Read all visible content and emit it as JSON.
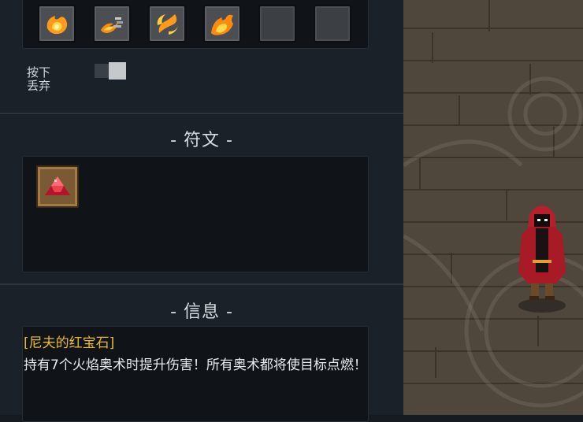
{
  "hotbar": {
    "slots": [
      {
        "icon": "fireball-icon",
        "filled": true
      },
      {
        "icon": "fire-dash-icon",
        "filled": true
      },
      {
        "icon": "fire-spin-icon",
        "filled": true
      },
      {
        "icon": "fire-burst-icon",
        "filled": true
      },
      {
        "icon": "empty-slot",
        "filled": false
      },
      {
        "icon": "empty-slot",
        "filled": false
      }
    ]
  },
  "hints": {
    "line1": "按下",
    "line2": "丢弃"
  },
  "runes": {
    "title": "- 符文 -",
    "items": [
      {
        "icon": "red-gem-icon"
      }
    ]
  },
  "info": {
    "title": "- 信息 -",
    "item_name": "[尼夫的红宝石]",
    "description": "持有7个火焰奥术时提升伤害！所有奥术都将使目标点燃！"
  },
  "colors": {
    "panel_bg": "#1b2128",
    "box_bg": "#101419",
    "item_name": "#e9b92e",
    "floor": "#4f463c",
    "cloak": "#b5202a"
  }
}
